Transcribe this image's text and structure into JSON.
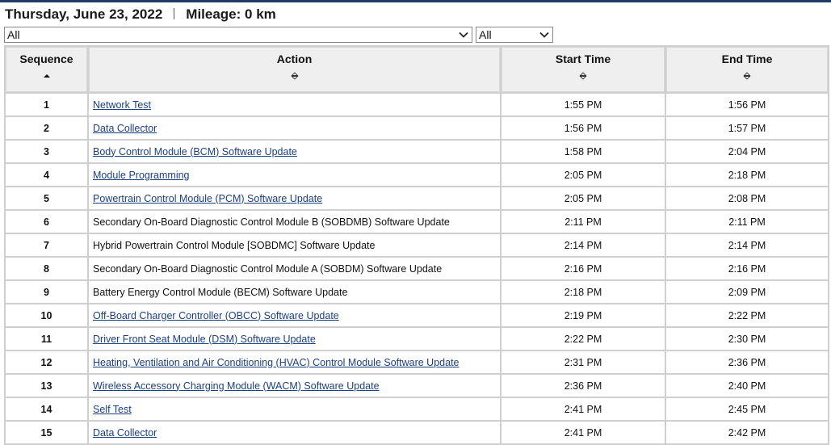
{
  "header": {
    "date": "Thursday, June 23, 2022",
    "mileage": "Mileage: 0 km"
  },
  "filters": {
    "action_filter": "All",
    "status_filter": "All"
  },
  "table": {
    "columns": [
      "Sequence",
      "Action",
      "Start Time",
      "End Time"
    ],
    "rows": [
      {
        "seq": "1",
        "action": "Network Test",
        "link": true,
        "start": "1:55 PM",
        "end": "1:56 PM"
      },
      {
        "seq": "2",
        "action": "Data Collector",
        "link": true,
        "start": "1:56 PM",
        "end": "1:57 PM"
      },
      {
        "seq": "3",
        "action": "Body Control Module (BCM) Software Update",
        "link": true,
        "start": "1:58 PM",
        "end": "2:04 PM"
      },
      {
        "seq": "4",
        "action": "Module Programming",
        "link": true,
        "start": "2:05 PM",
        "end": "2:18 PM"
      },
      {
        "seq": "5",
        "action": "Powertrain Control Module (PCM) Software Update",
        "link": true,
        "start": "2:05 PM",
        "end": "2:08 PM"
      },
      {
        "seq": "6",
        "action": "Secondary On-Board Diagnostic Control Module B (SOBDMB) Software Update",
        "link": false,
        "start": "2:11 PM",
        "end": "2:11 PM"
      },
      {
        "seq": "7",
        "action": "Hybrid Powertrain Control Module [SOBDMC] Software Update",
        "link": false,
        "start": "2:14 PM",
        "end": "2:14 PM"
      },
      {
        "seq": "8",
        "action": "Secondary On-Board Diagnostic Control Module A (SOBDM) Software Update",
        "link": false,
        "start": "2:16 PM",
        "end": "2:16 PM"
      },
      {
        "seq": "9",
        "action": "Battery Energy Control Module (BECM) Software Update",
        "link": false,
        "start": "2:18 PM",
        "end": "2:09 PM"
      },
      {
        "seq": "10",
        "action": "Off-Board Charger Controller (OBCC) Software Update",
        "link": true,
        "start": "2:19 PM",
        "end": "2:22 PM"
      },
      {
        "seq": "11",
        "action": "Driver Front Seat Module (DSM) Software Update",
        "link": true,
        "start": "2:22 PM",
        "end": "2:30 PM"
      },
      {
        "seq": "12",
        "action": "Heating, Ventilation and Air Conditioning (HVAC) Control Module Software Update",
        "link": true,
        "start": "2:31 PM",
        "end": "2:36 PM"
      },
      {
        "seq": "13",
        "action": "Wireless Accessory Charging Module (WACM) Software Update",
        "link": true,
        "start": "2:36 PM",
        "end": "2:40 PM"
      },
      {
        "seq": "14",
        "action": "Self Test",
        "link": true,
        "start": "2:41 PM",
        "end": "2:45 PM"
      },
      {
        "seq": "15",
        "action": "Data Collector",
        "link": true,
        "start": "2:41 PM",
        "end": "2:42 PM"
      }
    ]
  },
  "colors": {
    "link": "#1c3f80",
    "header_bg": "#efefef",
    "grid": "#cfcfcf",
    "top_rule": "#1f3b66"
  }
}
